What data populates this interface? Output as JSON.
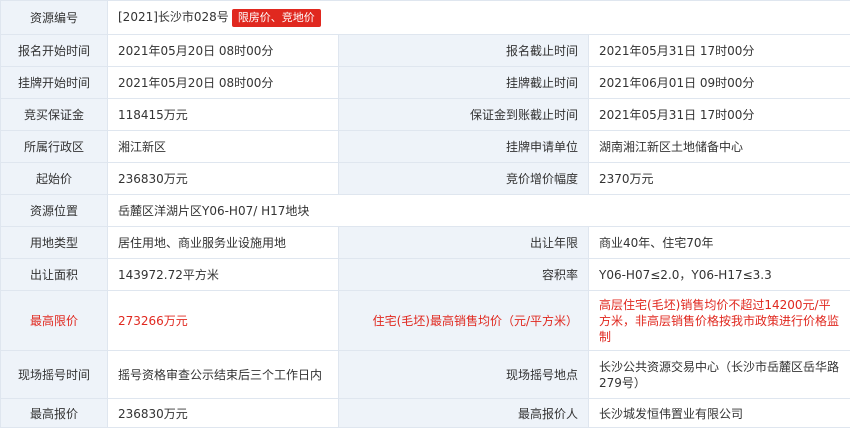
{
  "colors": {
    "label_bg": "#eef3f9",
    "border": "#dfe6ef",
    "highlight": "#e0281f"
  },
  "rows": [
    {
      "l1": "资源编号",
      "v1": "[2021]长沙市028号",
      "badge": "限房价、竞地价"
    },
    {
      "l1": "报名开始时间",
      "v1": "2021年05月20日 08时00分",
      "l2": "报名截止时间",
      "v2": "2021年05月31日 17时00分"
    },
    {
      "l1": "挂牌开始时间",
      "v1": "2021年05月20日 08时00分",
      "l2": "挂牌截止时间",
      "v2": "2021年06月01日 09时00分"
    },
    {
      "l1": "竞买保证金",
      "v1": "118415万元",
      "l2": "保证金到账截止时间",
      "v2": "2021年05月31日 17时00分"
    },
    {
      "l1": "所属行政区",
      "v1": "湘江新区",
      "l2": "挂牌申请单位",
      "v2": "湖南湘江新区土地储备中心"
    },
    {
      "l1": "起始价",
      "v1": "236830万元",
      "l2": "竞价增价幅度",
      "v2": "2370万元"
    },
    {
      "l1": "资源位置",
      "v1": "岳麓区洋湖片区Y06-H07/ H17地块"
    },
    {
      "l1": "用地类型",
      "v1": "居住用地、商业服务业设施用地",
      "l2": "出让年限",
      "v2": "商业40年、住宅70年"
    },
    {
      "l1": "出让面积",
      "v1": "143972.72平方米",
      "l2": "容积率",
      "v2": "Y06-H07≤2.0，Y06-H17≤3.3"
    },
    {
      "l1": "最高限价",
      "v1": "273266万元",
      "l2": "住宅(毛坯)最高销售均价（元/平方米）",
      "v2": "高层住宅(毛坯)销售均价不超过14200元/平方米，非高层销售价格按我市政策进行价格监制"
    },
    {
      "l1": "现场摇号时间",
      "v1": "摇号资格审查公示结束后三个工作日内",
      "l2": "现场摇号地点",
      "v2": "长沙公共资源交易中心（长沙市岳麓区岳华路279号）"
    },
    {
      "l1": "最高报价",
      "v1": "236830万元",
      "l2": "最高报价人",
      "v2": "长沙城发恒伟置业有限公司"
    }
  ]
}
